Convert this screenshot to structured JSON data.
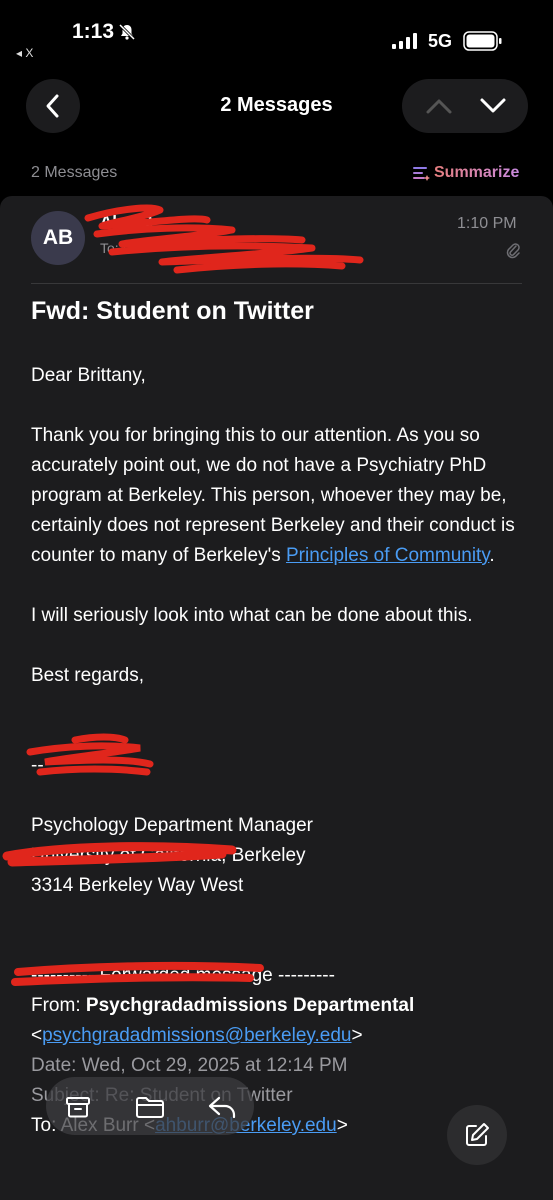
{
  "status": {
    "time": "1:13",
    "network": "5G",
    "back_app": "◂ X"
  },
  "nav": {
    "title": "2 Messages"
  },
  "thread": {
    "count_label": "2 Messages",
    "summarize_label": "Summarize"
  },
  "message": {
    "avatar_initials": "AB",
    "sender": "Alex B",
    "recipients": "To: Bri",
    "time": "1:10 PM",
    "subject": "Fwd: Student on Twitter",
    "greeting": "Dear Brittany,",
    "p1_before_link": "Thank you for bringing this to our attention. As you so accurately point out, we do not have a Psychiatry PhD program at Berkeley. This person, whoever they may be, certainly does not represent Berkeley and their conduct is counter to many of Berkeley's ",
    "p1_link": "Principles of Community",
    "p1_after_link": ".",
    "p2": "I will seriously look into what can be done about this.",
    "closing": "Best regards,",
    "sig_sep": "--",
    "sig_title": "Psychology Department Manager",
    "sig_org": "University of California, Berkeley",
    "sig_address": "3314 Berkeley Way West",
    "forward_header": "---------- Forwarded message ---------",
    "fwd_from_label": "From: ",
    "fwd_from_name": "Psychgradadmissions Departmental",
    "fwd_from_email_open": "<",
    "fwd_from_email": "psychgradadmissions@berkeley.edu",
    "fwd_from_email_close": ">",
    "fwd_date": "Date: Wed, Oct 29, 2025 at 12:14 PM",
    "fwd_subject": "Subject: Re: Student on Twitter",
    "fwd_to_label": "To: Alex Burr <",
    "fwd_to_email": "ahburr@berkeley.edu",
    "fwd_to_close": ">"
  },
  "colors": {
    "background": "#000000",
    "card": "#1c1c1e",
    "link": "#4a9cf4",
    "muted": "#8e8e93",
    "redaction": "#e0261c"
  }
}
